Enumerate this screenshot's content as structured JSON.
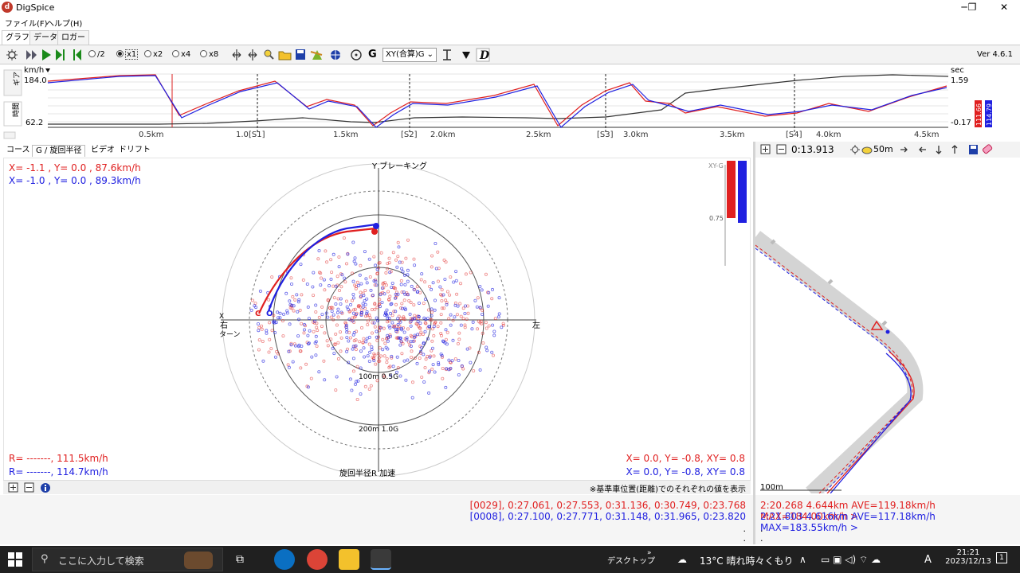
{
  "window": {
    "title": "DigSpice",
    "minimize_icon": "minimize-icon",
    "maximize_icon": "maximize-icon",
    "close_icon": "close-icon",
    "min_glyph": "─",
    "max_glyph": "❐",
    "close_glyph": "✕"
  },
  "menu": [
    "ファイル(F)",
    "ヘルプ(H)"
  ],
  "tabs": [
    "グラフ",
    "データ",
    "ロガー"
  ],
  "toolbar": {
    "rate_options": [
      "/2",
      "x1",
      "x2",
      "x4",
      "x8"
    ],
    "rate_selected": "x1",
    "xy_select": "XY(合算)G",
    "g_label": "G",
    "version": "Ver 4.6.1"
  },
  "graph": {
    "y_unit": "km/h",
    "y_max": "184.0",
    "y_min": "62.2",
    "right_unit": "sec",
    "right_max": "1.59",
    "right_min": "-0.17",
    "x_labels": [
      "0.5km",
      "1.0",
      "[S1]",
      "1.5km",
      "[S2]",
      "2.0km",
      "2.5km",
      "[S3]",
      "3.0km",
      "3.5km",
      "[S4]",
      "4.0km",
      "4.5km"
    ],
    "side_tabs": [
      "ギア",
      "時間"
    ],
    "badge_red": "111.66",
    "badge_blue": "114.79"
  },
  "left_tabs": [
    "コース",
    "G / 旋回半径",
    "ビデオ",
    "ドリフト"
  ],
  "polar": {
    "readout_red_top": "X= -1.1 , Y=  0.0 ,  87.6km/h",
    "readout_blue_top": "X= -1.0 , Y=  0.0 ,  89.3km/h",
    "readout_red_bottom": "R= -------, 111.5km/h",
    "readout_blue_bottom": "R= -------, 114.7km/h",
    "readout_red_right": "X=  0.0, Y= -0.8, XY= 0.8",
    "readout_blue_right": "X=  0.0, Y= -0.8, XY= 0.8",
    "label_top": "Y ブレーキング",
    "label_left_x": "X",
    "label_left": "右",
    "label_left2": "ターン",
    "label_right": "左",
    "label_bottom": "旋回半径R 加速",
    "ring1": "100m 0.5G",
    "ring2": "200m 1.0G",
    "xyg_label": "XY-G",
    "xyg_tick": "0.75",
    "red_marker": "C",
    "blue_marker": "O"
  },
  "bottom_note": "※基準車位置(距離)でのそれぞれの値を表示",
  "log": {
    "red": "[0029], 0:27.061, 0:27.553, 0:31.136, 0:30.749, 0:23.768",
    "blue": "[0008], 0:27.100, 0:27.771, 0:31.148, 0:31.965, 0:23.820",
    "dot": "."
  },
  "map_toolbar": {
    "time": "0:13.913",
    "scale": "50m",
    "zoom_in_icon": "zoom-in-icon",
    "zoom_out_icon": "zoom-out-icon"
  },
  "map": {
    "scale_label": "100m"
  },
  "map_log": {
    "red": "2:20.268 4.644km AVE=119.18km/h MAX=184.00km/h >",
    "blue": "2:21.803 4.616km AVE=117.18km/h MAX=183.55km/h >"
  },
  "taskbar": {
    "search_placeholder": "ここに入力して検索",
    "desktop": "デスクトップ",
    "weather": "13°C  晴れ時々くもり",
    "ime": "A",
    "time": "21:21",
    "date": "2023/12/13",
    "notif": "1"
  },
  "colors": {
    "red": "#e02020",
    "blue": "#2020e0"
  }
}
